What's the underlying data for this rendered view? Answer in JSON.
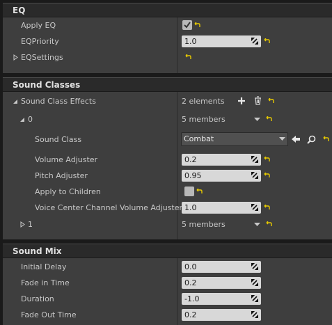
{
  "eq": {
    "header": "EQ",
    "apply_eq_label": "Apply EQ",
    "eq_priority_label": "EQPriority",
    "eq_priority_value": "1.0",
    "eq_settings_label": "EQSettings"
  },
  "sound_classes": {
    "header": "Sound Classes",
    "effects_label": "Sound Class Effects",
    "effects_count": "2 elements",
    "item0_index": "0",
    "item0_members": "5 members",
    "sound_class_label": "Sound Class",
    "sound_class_value": "Combat",
    "volume_label": "Volume Adjuster",
    "volume_value": "0.2",
    "pitch_label": "Pitch Adjuster",
    "pitch_value": "0.95",
    "apply_children_label": "Apply to Children",
    "voice_center_label": "Voice Center Channel Volume Adjuster",
    "voice_center_value": "1.0",
    "item1_index": "1",
    "item1_members": "5 members"
  },
  "sound_mix": {
    "header": "Sound Mix",
    "initial_delay_label": "Initial Delay",
    "initial_delay_value": "0.0",
    "fade_in_label": "Fade in Time",
    "fade_in_value": "0.2",
    "duration_label": "Duration",
    "duration_value": "-1.0",
    "fade_out_label": "Fade Out Time",
    "fade_out_value": "0.2"
  },
  "colors": {
    "panel": "#3e3e3e",
    "header": "#2a2a2a",
    "reset_arrow": "#e6c800"
  }
}
